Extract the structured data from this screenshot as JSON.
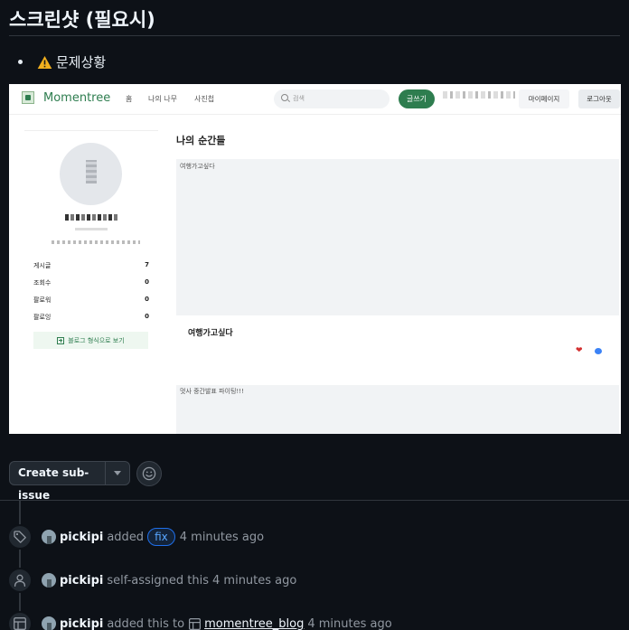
{
  "section": {
    "title": "스크린샷 (필요시)",
    "bullet": "문제상황",
    "bullet_icon": "warning-icon"
  },
  "screenshot": {
    "nav": {
      "logo": "Momentree",
      "links": [
        "홈",
        "나의 나무",
        "사진첩"
      ],
      "search_placeholder": "검색",
      "write_label": "글쓰기",
      "mypage_label": "마이페이지",
      "logout_label": "로그아웃"
    },
    "sidebar": {
      "stats": [
        {
          "label": "게시글",
          "value": "7"
        },
        {
          "label": "조회수",
          "value": "0"
        },
        {
          "label": "팔로워",
          "value": "0"
        },
        {
          "label": "팔로잉",
          "value": "0"
        }
      ],
      "blog_view_label": "블로그 형식으로 보기"
    },
    "main": {
      "title": "나의 순간들",
      "cards": [
        {
          "image_alt": "여행가고싶다",
          "title": "여행가고싶다"
        },
        {
          "image_alt": "멋사 중간발표 파이팅!!!"
        }
      ]
    }
  },
  "controls": {
    "create_sub_issue": "Create sub-issue"
  },
  "timeline": {
    "events": [
      {
        "icon": "tag-icon",
        "user": "pickipi",
        "pre": "added",
        "label": "fix",
        "time": "4 minutes ago"
      },
      {
        "icon": "person-icon",
        "user": "pickipi",
        "pre": "self-assigned this",
        "time": "4 minutes ago"
      },
      {
        "icon": "project-icon",
        "user": "pickipi",
        "pre": "added this to",
        "project": "momentree_blog",
        "time": "4 minutes ago"
      }
    ]
  },
  "colors": {
    "background": "#0d1117",
    "label_blue": "#58a6ff",
    "momentree_green": "#2e7d4f"
  }
}
